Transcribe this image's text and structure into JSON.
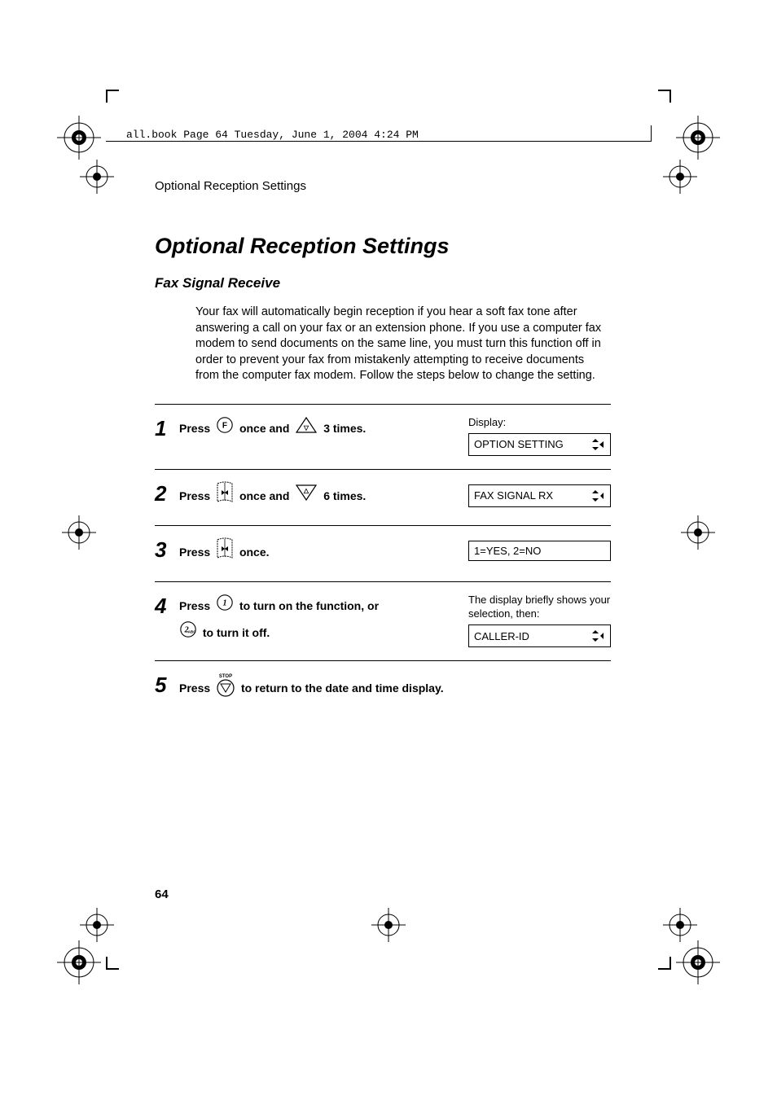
{
  "runhead": "all.book  Page 64  Tuesday, June 1, 2004  4:24 PM",
  "running_title": "Optional Reception Settings",
  "title": "Optional Reception Settings",
  "subtitle": "Fax Signal Receive",
  "intro": "Your fax will automatically begin reception if you hear a soft fax tone after answering a call on your fax or an extension phone. If you use a computer fax modem to send documents on the same line, you must turn this function off in order to prevent your fax from mistakenly attempting to receive documents from the computer fax modem. Follow the steps below to change the setting.",
  "steps": {
    "s1": {
      "num": "1",
      "text_a": "Press ",
      "text_b": " once and ",
      "text_c": " 3 times.",
      "disp_label": "Display:",
      "lcd": "OPTION SETTING"
    },
    "s2": {
      "num": "2",
      "text_a": "Press ",
      "text_b": " once and ",
      "text_c": " 6 times.",
      "lcd": "FAX SIGNAL RX"
    },
    "s3": {
      "num": "3",
      "text_a": "Press ",
      "text_b": " once.",
      "lcd": "1=YES, 2=NO"
    },
    "s4": {
      "num": "4",
      "text_a": "Press ",
      "text_b": " to turn on the function, or ",
      "text_c": " to turn it off.",
      "disp_note": "The display briefly shows your selection, then:",
      "lcd": "CALLER-ID"
    },
    "s5": {
      "num": "5",
      "text_a": "Press ",
      "text_b": " to return to the date and time display.",
      "stop_label": "STOP"
    }
  },
  "page_number": "64"
}
